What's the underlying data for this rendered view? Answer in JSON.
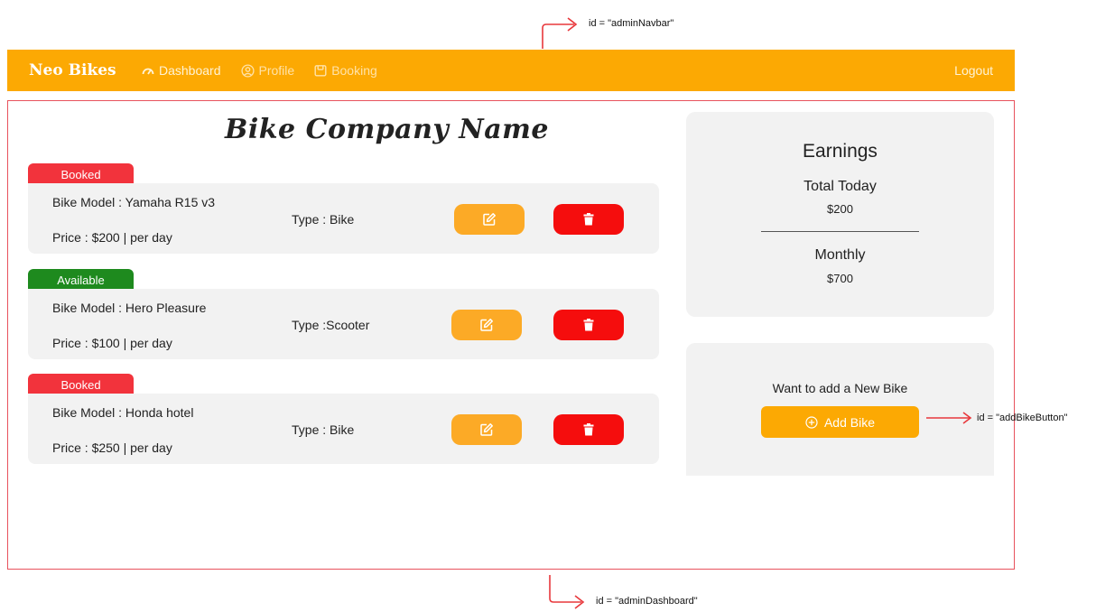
{
  "annotations": {
    "navbar_id": "id = \"adminNavbar\"",
    "add_button_id": "id = \"addBikeButton\"",
    "dashboard_id": "id = \"adminDashboard\"",
    "arrow_color": "#e8383c"
  },
  "navbar": {
    "brand": "Neo Bikes",
    "items": [
      {
        "label": "Dashboard",
        "icon": "speedometer-icon"
      },
      {
        "label": "Profile",
        "icon": "user-circle-icon"
      },
      {
        "label": "Booking",
        "icon": "calendar-icon"
      }
    ],
    "logout": "Logout",
    "color": "#fca903"
  },
  "dashboard": {
    "company_name": "Bike Company Name",
    "bikes": [
      {
        "status": "Booked",
        "model": "Bike Model : Yamaha R15 v3",
        "price": "Price : $200 | per day",
        "type": "Type : Bike"
      },
      {
        "status": "Available",
        "model": "Bike Model :  Hero Pleasure",
        "price": "Price : $100 | per day",
        "type": "Type :Scooter"
      },
      {
        "status": "Booked",
        "model": "Bike Model : Honda hotel",
        "price": "Price : $250 | per day",
        "type": "Type :  Bike"
      }
    ],
    "status_colors": {
      "Booked": "#f2333c",
      "Available": "#1e8a1e"
    },
    "edit_color": "#fcaa26",
    "delete_color": "#f50d0d"
  },
  "earnings": {
    "title": "Earnings",
    "today_label": "Total Today",
    "today_value": "$200",
    "monthly_label": "Monthly",
    "monthly_value": "$700"
  },
  "add_bike": {
    "prompt": "Want to add a New Bike",
    "button_label": "Add Bike",
    "button_icon": "plus-circle-icon"
  }
}
